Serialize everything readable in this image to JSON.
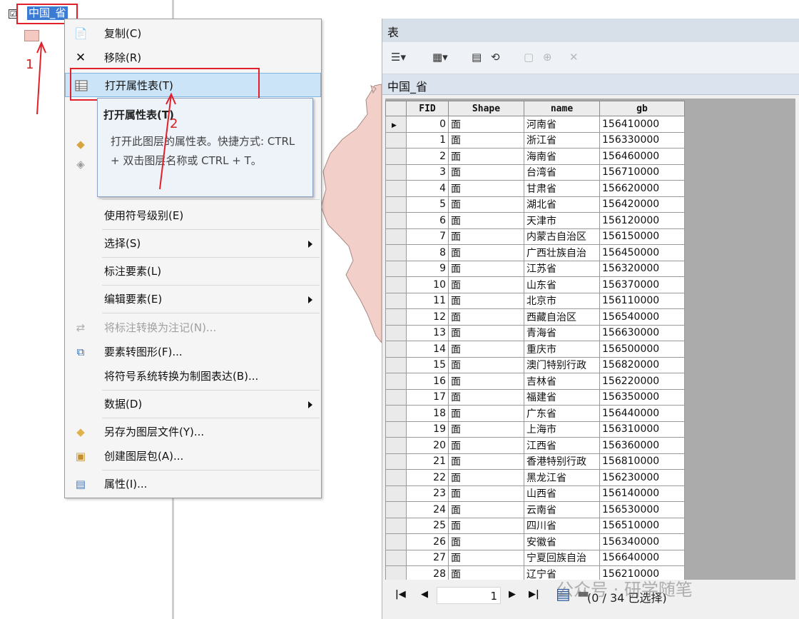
{
  "toc": {
    "layer_name": "中国_省",
    "swatch_color": "#f4c9c1",
    "checkmark": "☑"
  },
  "context_menu": {
    "items": [
      {
        "label": "复制(C)",
        "icon": "copy-icon"
      },
      {
        "label": "移除(R)",
        "icon": "remove-icon"
      },
      {
        "label": "打开属性表(T)",
        "icon": "table-icon"
      },
      {
        "label": "使用符号级别(E)"
      },
      {
        "label": "选择(S)",
        "submenu": true
      },
      {
        "label": "标注要素(L)"
      },
      {
        "label": "编辑要素(E)",
        "submenu": true
      },
      {
        "label": "将标注转换为注记(N)...",
        "disabled": true,
        "icon": "convert-labels-icon"
      },
      {
        "label": "要素转图形(F)...",
        "icon": "features-to-graphics-icon"
      },
      {
        "label": "将符号系统转换为制图表达(B)..."
      },
      {
        "label": "数据(D)",
        "submenu": true
      },
      {
        "label": "另存为图层文件(Y)...",
        "icon": "layer-file-icon"
      },
      {
        "label": "创建图层包(A)...",
        "icon": "layer-package-icon"
      },
      {
        "label": "属性(I)...",
        "icon": "properties-icon"
      }
    ]
  },
  "tooltip": {
    "title": "打开属性表(T)",
    "body": "打开此图层的属性表。快捷方式: CTRL + 双击图层名称或 CTRL + T。"
  },
  "annotations": {
    "step1": "1",
    "step2": "2",
    "color": "#e0202a"
  },
  "table_window": {
    "title": "表",
    "tab_label": "中国_省",
    "columns": [
      "FID",
      "Shape",
      "name",
      "gb"
    ],
    "rows": [
      [
        "0",
        "面",
        "河南省",
        "156410000"
      ],
      [
        "1",
        "面",
        "浙江省",
        "156330000"
      ],
      [
        "2",
        "面",
        "海南省",
        "156460000"
      ],
      [
        "3",
        "面",
        "台湾省",
        "156710000"
      ],
      [
        "4",
        "面",
        "甘肃省",
        "156620000"
      ],
      [
        "5",
        "面",
        "湖北省",
        "156420000"
      ],
      [
        "6",
        "面",
        "天津市",
        "156120000"
      ],
      [
        "7",
        "面",
        "内蒙古自治区",
        "156150000"
      ],
      [
        "8",
        "面",
        "广西壮族自治",
        "156450000"
      ],
      [
        "9",
        "面",
        "江苏省",
        "156320000"
      ],
      [
        "10",
        "面",
        "山东省",
        "156370000"
      ],
      [
        "11",
        "面",
        "北京市",
        "156110000"
      ],
      [
        "12",
        "面",
        "西藏自治区",
        "156540000"
      ],
      [
        "13",
        "面",
        "青海省",
        "156630000"
      ],
      [
        "14",
        "面",
        "重庆市",
        "156500000"
      ],
      [
        "15",
        "面",
        "澳门特别行政",
        "156820000"
      ],
      [
        "16",
        "面",
        "吉林省",
        "156220000"
      ],
      [
        "17",
        "面",
        "福建省",
        "156350000"
      ],
      [
        "18",
        "面",
        "广东省",
        "156440000"
      ],
      [
        "19",
        "面",
        "上海市",
        "156310000"
      ],
      [
        "20",
        "面",
        "江西省",
        "156360000"
      ],
      [
        "21",
        "面",
        "香港特别行政",
        "156810000"
      ],
      [
        "22",
        "面",
        "黑龙江省",
        "156230000"
      ],
      [
        "23",
        "面",
        "山西省",
        "156140000"
      ],
      [
        "24",
        "面",
        "云南省",
        "156530000"
      ],
      [
        "25",
        "面",
        "四川省",
        "156510000"
      ],
      [
        "26",
        "面",
        "安徽省",
        "156340000"
      ],
      [
        "27",
        "面",
        "宁夏回族自治",
        "156640000"
      ],
      [
        "28",
        "面",
        "辽宁省",
        "156210000"
      ]
    ],
    "navigator": {
      "current_page": "1",
      "status": "(0 / 34 已选择)"
    }
  },
  "watermark": "公众号 · 研学随笔"
}
